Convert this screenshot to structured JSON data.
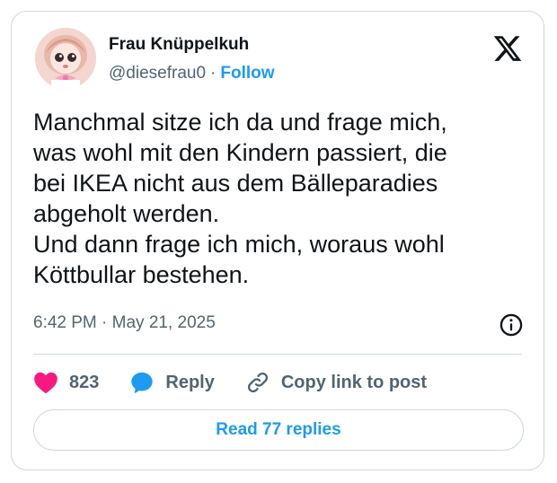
{
  "author": {
    "display_name": "Frau Knüppelkuh",
    "handle": "@diesefrau0",
    "separator": "·",
    "follow_label": "Follow",
    "avatar_icon": "doll-avatar-icon"
  },
  "platform_icon": "x-logo-icon",
  "tweet": {
    "lines": [
      "Manchmal sitze ich da und frage mich,",
      "was wohl mit den Kindern passiert, die",
      "bei IKEA nicht aus dem Bälleparadies",
      "abgeholt werden.",
      "Und dann frage ich mich, woraus wohl",
      "Köttbullar bestehen."
    ]
  },
  "meta": {
    "timestamp": "6:42 PM · May 21, 2025",
    "info_icon": "info-icon"
  },
  "actions": {
    "like_count": "823",
    "reply_label": "Reply",
    "copy_link_label": "Copy link to post"
  },
  "read_replies_label": "Read 77 replies",
  "colors": {
    "accent": "#1d9bf0",
    "like": "#f91880",
    "text": "#0f1419",
    "muted": "#536471",
    "border": "#cfd9de"
  }
}
